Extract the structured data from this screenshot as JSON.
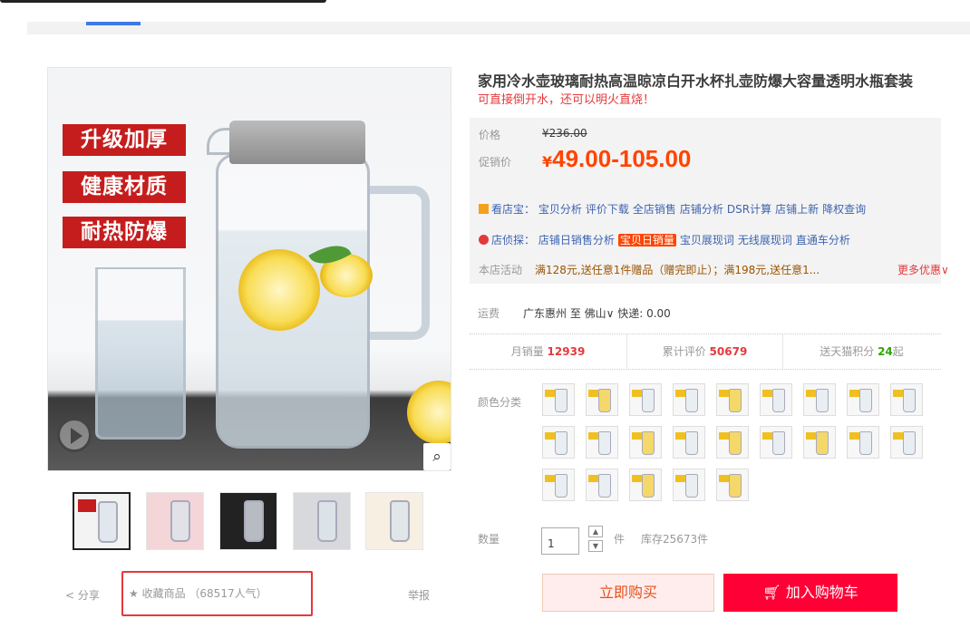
{
  "product": {
    "title": "家用冷水壶玻璃耐热高温晾凉白开水杯扎壶防爆大容量透明水瓶套装",
    "subtitle": "可直接倒开水，还可以明火直烧！"
  },
  "gallery": {
    "promo_lines": [
      "升级加厚",
      "健康材质",
      "耐热防爆"
    ],
    "zoom_icon": "magnifier-icon",
    "play_icon": "play-icon"
  },
  "price": {
    "original_label": "价格",
    "original_value": "¥236.00",
    "promo_label": "促销价",
    "currency": "¥",
    "promo_value": "49.00-105.00"
  },
  "kandianbao": {
    "label": "看店宝：",
    "links": [
      "宝贝分析",
      "评价下载",
      "全店销售",
      "店铺分析",
      "DSR计算",
      "店铺上新",
      "降权查询"
    ]
  },
  "dianzhentan": {
    "label": "店侦探：",
    "links": [
      "店铺日销售分析",
      "宝贝日销量",
      "宝贝展现词",
      "无线展现词",
      "直通车分析"
    ]
  },
  "store_promo": {
    "label": "本店活动",
    "text": "满128元,送任意1件赠品（赠完即止）；满198元,送任意1...",
    "more": "更多优惠"
  },
  "shipping": {
    "label": "运费",
    "route": "广东惠州 至 佛山∨ 快递: 0.00"
  },
  "stats": [
    {
      "label": "月销量",
      "value": "12939",
      "suffix": ""
    },
    {
      "label": "累计评价",
      "value": "50679",
      "suffix": ""
    },
    {
      "label": "送天猫积分",
      "value": "24",
      "suffix": "起"
    }
  ],
  "options": {
    "color_label": "颜色分类",
    "qty_label": "数量",
    "qty_value": "1",
    "qty_unit": "件",
    "stock": "库存25673件"
  },
  "actions": {
    "share": "分享",
    "favorite": "收藏商品 （68517人气）",
    "report": "举报",
    "buy_now": "立即购买",
    "add_cart": "加入购物车"
  },
  "colors": {
    "price": "#ff4400",
    "cart_button": "#ff0036",
    "link": "#3e64b0"
  }
}
